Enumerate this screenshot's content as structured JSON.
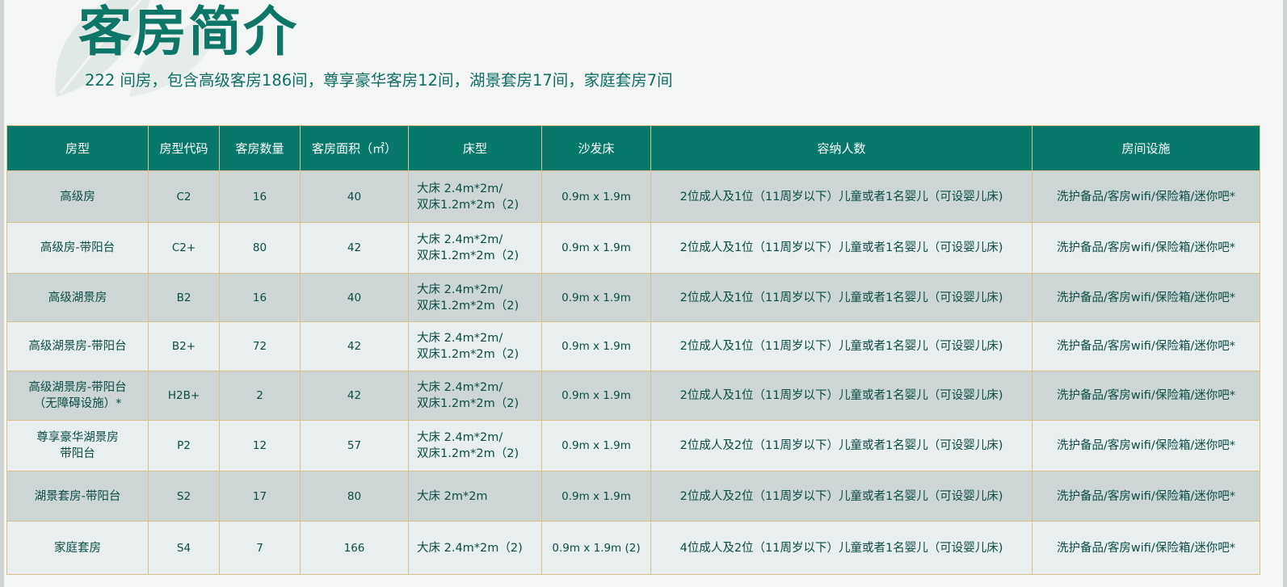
{
  "title": "客房简介",
  "subtitle": "222 间房，包含高级客房186间，尊享豪华客房12间，湖景套房17间，家庭套房7间",
  "table": {
    "headers": [
      "房型",
      "房型代码",
      "客房数量",
      "客房面积（㎡）",
      "床型",
      "沙发床",
      "容纳人数",
      "房间设施"
    ],
    "rows": [
      {
        "type": "高级房",
        "code": "C2",
        "count": "16",
        "area": "40",
        "bed": "大床 2.4m*2m/\n双床1.2m*2m（2)",
        "sofa": "0.9m x 1.9m",
        "capacity": "2位成人及1位（11周岁以下）儿童或者1名婴儿（可设婴儿床)",
        "facilities": "洗护备品/客房wifi/保险箱/迷你吧*"
      },
      {
        "type": "高级房-带阳台",
        "code": "C2+",
        "count": "80",
        "area": "42",
        "bed": "大床 2.4m*2m/\n双床1.2m*2m（2)",
        "sofa": "0.9m x 1.9m",
        "capacity": "2位成人及1位（11周岁以下）儿童或者1名婴儿（可设婴儿床)",
        "facilities": "洗护备品/客房wifi/保险箱/迷你吧*"
      },
      {
        "type": "高级湖景房",
        "code": "B2",
        "count": "16",
        "area": "40",
        "bed": "大床 2.4m*2m/\n双床1.2m*2m（2)",
        "sofa": "0.9m x 1.9m",
        "capacity": "2位成人及1位（11周岁以下）儿童或者1名婴儿（可设婴儿床)",
        "facilities": "洗护备品/客房wifi/保险箱/迷你吧*"
      },
      {
        "type": "高级湖景房-带阳台",
        "code": "B2+",
        "count": "72",
        "area": "42",
        "bed": "大床 2.4m*2m/\n双床1.2m*2m（2)",
        "sofa": "0.9m x 1.9m",
        "capacity": "2位成人及1位（11周岁以下）儿童或者1名婴儿（可设婴儿床)",
        "facilities": "洗护备品/客房wifi/保险箱/迷你吧*"
      },
      {
        "type": "高级湖景房-带阳台\n（无障碍设施）*",
        "code": "H2B+",
        "count": "2",
        "area": "42",
        "bed": "大床 2.4m*2m/\n双床1.2m*2m（2)",
        "sofa": "0.9m x 1.9m",
        "capacity": "2位成人及1位（11周岁以下）儿童或者1名婴儿（可设婴儿床)",
        "facilities": "洗护备品/客房wifi/保险箱/迷你吧*"
      },
      {
        "type": "尊享豪华湖景房\n带阳台",
        "code": "P2",
        "count": "12",
        "area": "57",
        "bed": "大床 2.4m*2m/\n双床1.2m*2m（2)",
        "sofa": "0.9m x 1.9m",
        "capacity": "2位成人及2位（11周岁以下）儿童或者1名婴儿（可设婴儿床)",
        "facilities": "洗护备品/客房wifi/保险箱/迷你吧*"
      },
      {
        "type": "湖景套房-带阳台",
        "code": "S2",
        "count": "17",
        "area": "80",
        "bed": "大床 2m*2m",
        "sofa": "0.9m x 1.9m",
        "capacity": "2位成人及2位（11周岁以下）儿童或者1名婴儿（可设婴儿床)",
        "facilities": "洗护备品/客房wifi/保险箱/迷你吧*"
      },
      {
        "type": "家庭套房",
        "code": "S4",
        "count": "7",
        "area": "166",
        "bed": "大床 2.4m*2m（2)",
        "sofa": "0.9m x 1.9m (2)",
        "capacity": "4位成人及2位（11周岁以下）儿童或者1名婴儿（可设婴儿床)",
        "facilities": "洗护备品/客房wifi/保险箱/迷你吧*"
      }
    ]
  },
  "colors": {
    "header_bg": "#08786a",
    "title": "#0e7666",
    "border": "#d9c08a",
    "row_dark": "#cdd6d5",
    "row_light": "#e9eeee"
  }
}
